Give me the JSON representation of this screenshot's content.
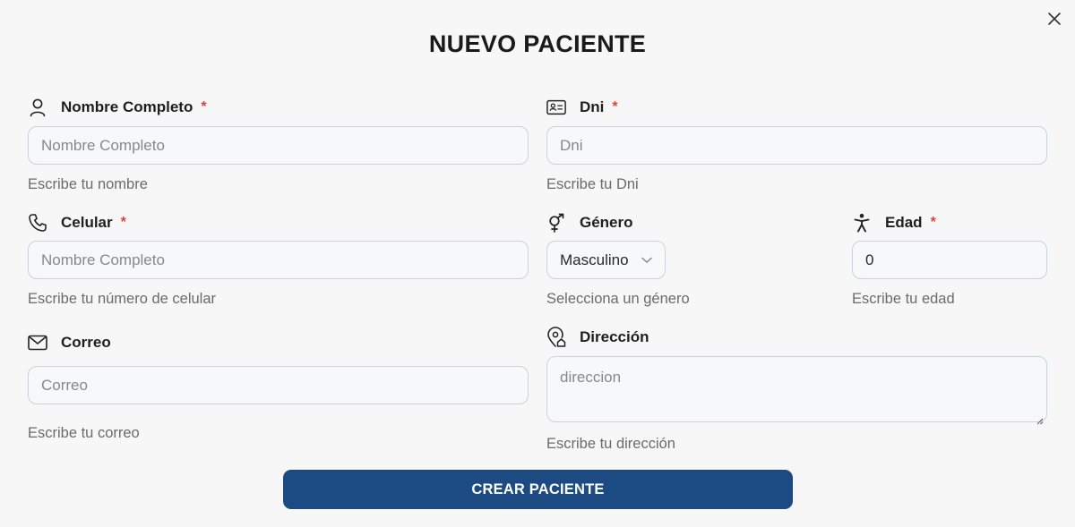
{
  "modal": {
    "title": "NUEVO PACIENTE",
    "submit_label": "CREAR PACIENTE"
  },
  "fields": {
    "nombre": {
      "label": "Nombre Completo",
      "required_mark": "*",
      "placeholder": "Nombre Completo",
      "helper": "Escribe tu nombre",
      "icon": "user-icon"
    },
    "dni": {
      "label": "Dni",
      "required_mark": "*",
      "placeholder": "Dni",
      "helper": "Escribe tu Dni",
      "icon": "id-card-icon"
    },
    "celular": {
      "label": "Celular",
      "required_mark": "*",
      "placeholder": "Nombre Completo",
      "helper": "Escribe tu número de celular",
      "icon": "phone-icon"
    },
    "genero": {
      "label": "Género",
      "value": "Masculino",
      "helper": "Selecciona un género",
      "icon": "gender-icon"
    },
    "edad": {
      "label": "Edad",
      "required_mark": "*",
      "value": "0",
      "helper": "Escribe tu edad",
      "icon": "person-accessibility-icon"
    },
    "correo": {
      "label": "Correo",
      "placeholder": "Correo",
      "helper": "Escribe tu correo",
      "icon": "mail-icon"
    },
    "direccion": {
      "label": "Dirección",
      "placeholder": "direccion",
      "helper": "Escribe tu dirección",
      "icon": "location-home-icon"
    }
  },
  "colors": {
    "primary": "#1c4a82",
    "required": "#e53e3e",
    "border": "#c9d2de",
    "background": "#f7f7f8"
  }
}
